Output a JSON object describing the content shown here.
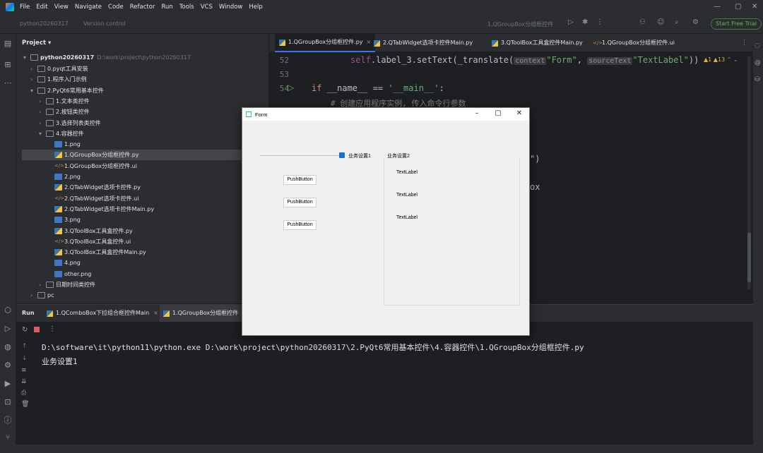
{
  "menu": [
    "File",
    "Edit",
    "View",
    "Navigate",
    "Code",
    "Refactor",
    "Run",
    "Tools",
    "VCS",
    "Window",
    "Help"
  ],
  "toolbar": {
    "project_widget": "python20260317",
    "vcs_widget": "Version control",
    "run_config": "1.QGroupBox分组框控件",
    "free_trial": "Start Free Trial"
  },
  "project": {
    "header": "Project",
    "root": {
      "name": "python20260317",
      "path": "D:\\work\\project\\python20260317"
    },
    "items": [
      {
        "label": "0.pyqt工具安装",
        "type": "folder"
      },
      {
        "label": "1.程序入门示例",
        "type": "folder"
      },
      {
        "label": "2.PyQt6常用基本控件",
        "type": "folder"
      },
      {
        "label": "1.文本类控件",
        "type": "folder"
      },
      {
        "label": "2.按钮类控件",
        "type": "folder"
      },
      {
        "label": "3.选择列表类控件",
        "type": "folder"
      },
      {
        "label": "4.容器控件",
        "type": "folder"
      },
      {
        "label": "1.png",
        "type": "png"
      },
      {
        "label": "1.QGroupBox分组框控件.py",
        "type": "py"
      },
      {
        "label": "1.QGroupBox分组框控件.ui",
        "type": "ui"
      },
      {
        "label": "2.png",
        "type": "png"
      },
      {
        "label": "2.QTabWidget选项卡控件.py",
        "type": "py"
      },
      {
        "label": "2.QTabWidget选项卡控件.ui",
        "type": "ui"
      },
      {
        "label": "2.QTabWidget选项卡控件Main.py",
        "type": "py"
      },
      {
        "label": "3.png",
        "type": "png"
      },
      {
        "label": "3.QToolBox工具盒控件.py",
        "type": "py"
      },
      {
        "label": "3.QToolBox工具盒控件.ui",
        "type": "ui"
      },
      {
        "label": "3.QToolBox工具盒控件Main.py",
        "type": "py"
      },
      {
        "label": "4.png",
        "type": "png"
      },
      {
        "label": "other.png",
        "type": "png"
      },
      {
        "label": "日期时间类控件",
        "type": "folder"
      },
      {
        "label": "pc",
        "type": "folder"
      }
    ]
  },
  "editor": {
    "tabs": [
      "1.QGroupBox分组框控件.py",
      "2.QTabWidget选项卡控件Main.py",
      "3.QToolBox工具盒控件Main.py",
      "1.QGroupBox分组框控件.ui"
    ],
    "lines": [
      "52",
      "53",
      "54"
    ],
    "code": {
      "l52_a": "self",
      "l52_b": ".label_3.setText(_translate(",
      "l52_hint1": "context",
      "l52_s1": "\"Form\"",
      "l52_c": ", ",
      "l52_hint2": "sourceText",
      "l52_s2": "\"TextLabel\"",
      "l52_d": "))",
      "l54_kw": "if",
      "l54_a": " __name__ == ",
      "l54_s": "'__main__'",
      "l54_b": ":",
      "l55": "# 创建应用程序实例, 传入命令行参数",
      "frag1": "\")",
      "frag2": "ox"
    },
    "warnings": {
      "w1": "1",
      "w2": "13"
    }
  },
  "run": {
    "label": "Run",
    "tabs": [
      "1.QComboBox下拉组合框控件Main",
      "1.QGroupBox分组框控件"
    ],
    "console": [
      "D:\\software\\it\\python11\\python.exe D:\\work\\project\\python20260317\\2.PyQt6常用基本控件\\4.容器控件\\1.QGroupBox分组框控件.py",
      "业务设置1"
    ]
  },
  "form": {
    "title": "Form",
    "group1_title": "业务设置1",
    "group2_title": "业务设置2",
    "buttons": [
      "PushButton",
      "PushButton",
      "PushButton"
    ],
    "labels": [
      "TextLabel",
      "TextLabel",
      "TextLabel"
    ]
  },
  "colors": {
    "accent": "#3574f0",
    "bg": "#1e1f22",
    "panel": "#2b2d30"
  }
}
